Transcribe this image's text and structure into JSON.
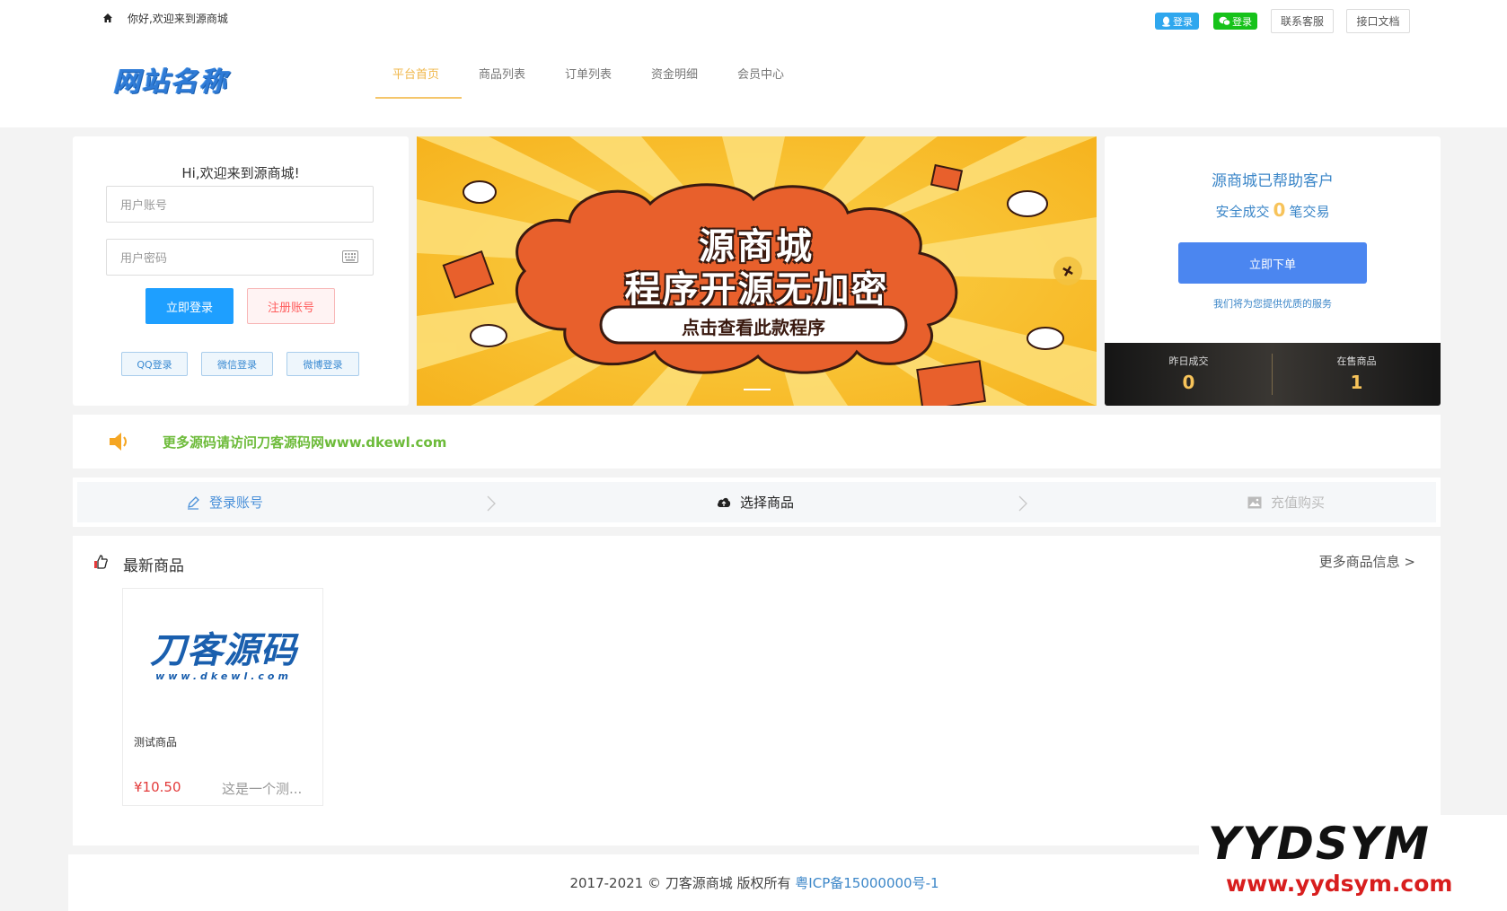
{
  "header": {
    "greeting": "你好,欢迎来到源商城",
    "qq_login_badge": "登录",
    "wechat_login_badge": "登录",
    "contact_service": "联系客服",
    "api_docs": "接口文档",
    "logo_text": "网站名称",
    "nav": [
      {
        "label": "平台首页",
        "active": true
      },
      {
        "label": "商品列表"
      },
      {
        "label": "订单列表"
      },
      {
        "label": "资金明细"
      },
      {
        "label": "会员中心"
      }
    ]
  },
  "login": {
    "title": "Hi,欢迎来到源商城!",
    "username_placeholder": "用户账号",
    "password_placeholder": "用户密码",
    "login_button": "立即登录",
    "register_button": "注册账号",
    "qq_login": "QQ登录",
    "wechat_login": "微信登录",
    "weibo_login": "微博登录"
  },
  "banner": {
    "title": "源商城",
    "subtitle": "程序开源无加密",
    "cta": "点击查看此款程序"
  },
  "stats": {
    "helped": "源商城已帮助客户",
    "safe_prefix": "安全成交",
    "safe_count": "0",
    "safe_suffix": "笔交易",
    "order_button": "立即下单",
    "service_text": "我们将为您提供优质的服务",
    "yesterday_label": "昨日成交",
    "yesterday_value": "0",
    "on_sale_label": "在售商品",
    "on_sale_value": "1"
  },
  "notice": {
    "text": "更多源码请访问刀客源码网www.dkewl.com"
  },
  "steps": [
    {
      "label": "登录账号"
    },
    {
      "label": "选择商品",
      "active": true
    },
    {
      "label": "充值购买"
    }
  ],
  "products": {
    "title": "最新商品",
    "more": "更多商品信息 >",
    "items": [
      {
        "logo_main": "刀客源码",
        "logo_sub": "www.dkewl.com",
        "name": "测试商品",
        "price": "¥10.50",
        "desc": "这是一个测..."
      }
    ]
  },
  "footer": {
    "copyright": "2017-2021 © 刀客源商城 版权所有",
    "icp": "粤ICP备15000000号-1"
  },
  "watermark": {
    "top": "YYDSYM",
    "bottom": "www.yydsym.com"
  },
  "colors": {
    "accent_blue": "#1e9fff",
    "order_blue": "#4b86f0",
    "nav_active": "#f5c66b",
    "notice_green": "#6dbb3a",
    "price_red": "#e33b3b"
  }
}
